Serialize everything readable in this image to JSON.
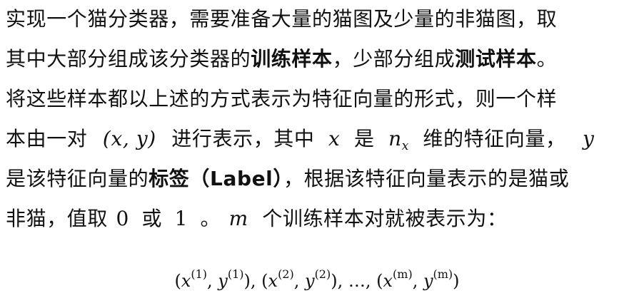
{
  "paragraph": {
    "line1": "实现一个猫分类器，需要准备大量的猫图及少量的非猫图，取",
    "line2_a": "其中大部分组成该分类器的",
    "line2_b": "训练样本",
    "line2_c": "，少部分组成",
    "line2_d": "测试样本",
    "line2_e": "。",
    "line3": "将这些样本都以上述的方式表示为特征向量的形式，则一个样",
    "line4_a": "本由一对",
    "line4_pair": "(x, y)",
    "line4_b": "进行表示，其中",
    "line4_x": "x",
    "line4_c": "是",
    "line4_n": "n",
    "line4_nsub": "x",
    "line4_d": "维的特征向量，",
    "line4_y": "y",
    "line5_a": "是该特征向量的",
    "line5_b": "标签（Label）",
    "line5_c": "，根据该特征向量表示的是猫或",
    "line6_a": "非猫，值取",
    "line6_zero": "0",
    "line6_b": "或",
    "line6_one": "1",
    "line6_c": "。",
    "line6_m": "m",
    "line6_d": "个训练样本对就被表示为："
  },
  "formula": {
    "x": "x",
    "y": "y",
    "sup1": "(1)",
    "sup2": "(2)",
    "supm": "(m)",
    "dots": "…"
  }
}
